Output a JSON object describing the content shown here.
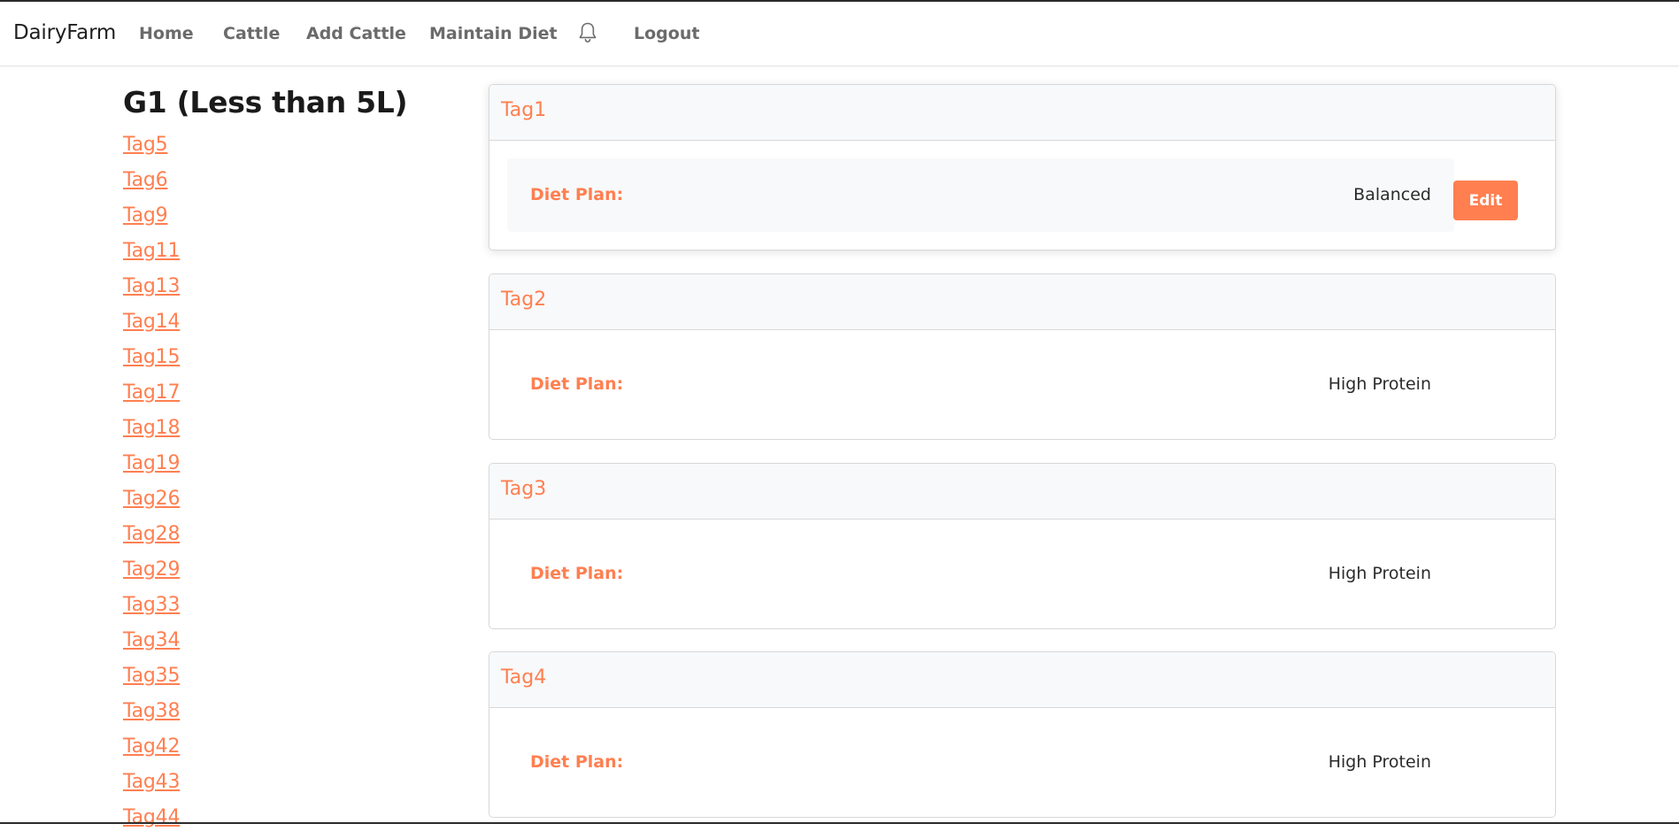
{
  "nav": {
    "brand": "DairyFarm",
    "links": [
      "Home",
      "Cattle",
      "Add Cattle",
      "Maintain Diet",
      "Logout"
    ],
    "notification_icon": "bell-icon"
  },
  "sidebar": {
    "title": "G1 (Less than 5L)",
    "tags": [
      "Tag5",
      "Tag6",
      "Tag9",
      "Tag11",
      "Tag13",
      "Tag14",
      "Tag15",
      "Tag17",
      "Tag18",
      "Tag19",
      "Tag26",
      "Tag28",
      "Tag29",
      "Tag33",
      "Tag34",
      "Tag35",
      "Tag38",
      "Tag42",
      "Tag43",
      "Tag44"
    ]
  },
  "cards": [
    {
      "tag": "Tag1",
      "label": "Diet Plan:",
      "value": "Balanced",
      "edit_label": "Edit"
    },
    {
      "tag": "Tag2",
      "label": "Diet Plan:",
      "value": "High Protein"
    },
    {
      "tag": "Tag3",
      "label": "Diet Plan:",
      "value": "High Protein"
    },
    {
      "tag": "Tag4",
      "label": "Diet Plan:",
      "value": "High Protein"
    }
  ],
  "colors": {
    "accent": "#ff7f50",
    "nav_text": "#6b6b6b",
    "card_header_bg": "#f8f9fa"
  }
}
